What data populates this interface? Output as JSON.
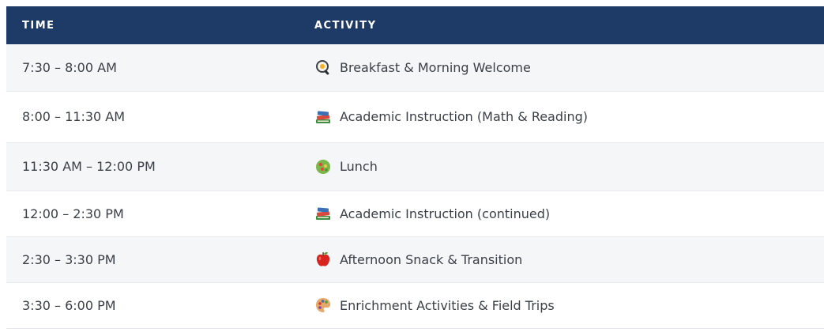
{
  "table": {
    "headers": {
      "time": "TIME",
      "activity": "ACTIVITY"
    },
    "colors": {
      "header_bg": "#1e3a66",
      "header_text": "#ffffff",
      "row_alt_bg": "#f5f6f8",
      "row_bg": "#ffffff",
      "border": "#e7e9ee",
      "text": "#3a3f47"
    },
    "rows": [
      {
        "time": "7:30 – 8:00 AM",
        "activity": "Breakfast & Morning Welcome",
        "icon": "frying-pan-egg-icon"
      },
      {
        "time": "8:00 – 11:30 AM",
        "activity": "Academic Instruction (Math & Reading)",
        "icon": "books-icon"
      },
      {
        "time": "11:30 AM – 12:00 PM",
        "activity": "Lunch",
        "icon": "salad-icon"
      },
      {
        "time": "12:00 – 2:30 PM",
        "activity": "Academic Instruction (continued)",
        "icon": "books-icon"
      },
      {
        "time": "2:30 – 3:30 PM",
        "activity": "Afternoon Snack & Transition",
        "icon": "apple-icon"
      },
      {
        "time": "3:30 – 6:00 PM",
        "activity": "Enrichment Activities & Field Trips",
        "icon": "palette-icon"
      }
    ]
  }
}
